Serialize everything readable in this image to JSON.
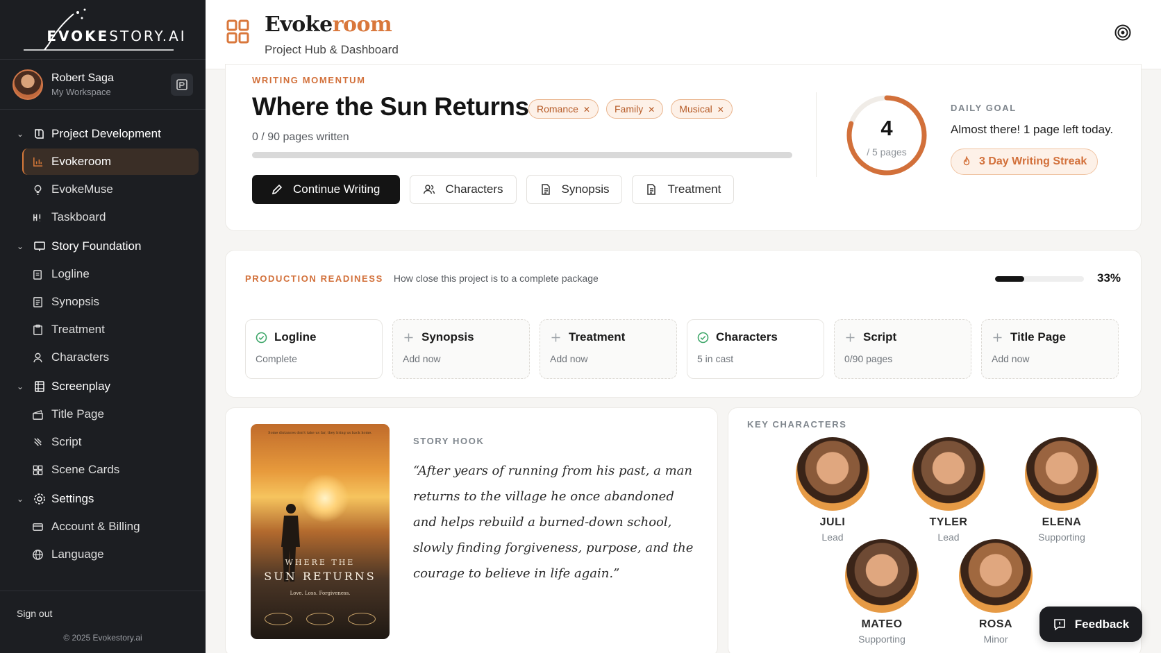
{
  "sidebar": {
    "brand_prefix": "EVOKE",
    "brand_suffix": "STORY.AI",
    "user": {
      "name": "Robert Saga",
      "workspace": "My Workspace"
    },
    "sections": [
      {
        "label": "Project Development",
        "items": [
          "Evokeroom",
          "EvokeMuse",
          "Taskboard"
        ]
      },
      {
        "label": "Story Foundation",
        "items": [
          "Logline",
          "Synopsis",
          "Treatment",
          "Characters"
        ]
      },
      {
        "label": "Screenplay",
        "items": [
          "Title Page",
          "Script",
          "Scene Cards"
        ]
      },
      {
        "label": "Settings",
        "items": [
          "Account & Billing",
          "Language"
        ]
      }
    ],
    "active_item": "Evokeroom",
    "sign_out": "Sign out",
    "copyright": "© 2025 Evokestory.ai"
  },
  "header": {
    "brand_dark": "Evoke",
    "brand_accent": "room",
    "subtitle": "Project Hub & Dashboard"
  },
  "momentum": {
    "eyebrow": "WRITING MOMENTUM",
    "title": "Where the Sun Returns",
    "tags": [
      "Romance",
      "Family",
      "Musical"
    ],
    "pages_text": "0 / 90 pages written",
    "progress": 0,
    "actions": [
      "Continue Writing",
      "Characters",
      "Synopsis",
      "Treatment"
    ],
    "goal_value": "4",
    "goal_label": "/ 5 pages",
    "goal_fraction": 0.8,
    "daily_goal_label": "DAILY GOAL",
    "daily_goal_msg": "Almost there! 1 page left today.",
    "streak": "3 Day Writing Streak"
  },
  "readiness": {
    "eyebrow": "PRODUCTION READINESS",
    "description": "How close this project is to a complete package",
    "percent_text": "33%",
    "percent": 33,
    "tiles": [
      {
        "title": "Logline",
        "sub": "Complete",
        "done": true
      },
      {
        "title": "Synopsis",
        "sub": "Add now",
        "done": false
      },
      {
        "title": "Treatment",
        "sub": "Add now",
        "done": false
      },
      {
        "title": "Characters",
        "sub": "5 in cast",
        "done": true
      },
      {
        "title": "Script",
        "sub": "0/90 pages",
        "done": false
      },
      {
        "title": "Title Page",
        "sub": "Add now",
        "done": false
      }
    ]
  },
  "hook": {
    "eyebrow": "STORY HOOK",
    "quote": "“After years of running from his past, a man returns to the village he once abandoned and helps rebuild a burned-down school, slowly finding forgiveness, purpose, and the courage to believe in life again.”",
    "poster": {
      "tagline": "Some distances don't take us far, they bring us back home.",
      "line1": "WHERE THE",
      "line2": "SUN RETURNS",
      "line3": "Love. Loss. Forgiveness."
    }
  },
  "characters": {
    "eyebrow": "KEY CHARACTERS",
    "list": [
      {
        "name": "JULI",
        "role": "Lead",
        "color": "#8a5a3a"
      },
      {
        "name": "TYLER",
        "role": "Lead",
        "color": "#7a5238"
      },
      {
        "name": "ELENA",
        "role": "Supporting",
        "color": "#9a6440"
      },
      {
        "name": "MATEO",
        "role": "Supporting",
        "color": "#6e4a34"
      },
      {
        "name": "ROSA",
        "role": "Minor",
        "color": "#a0683f"
      }
    ]
  },
  "feedback": "Feedback",
  "colors": {
    "accent": "#d2703a",
    "sidebar": "#1c1e22",
    "dark": "#141414"
  }
}
